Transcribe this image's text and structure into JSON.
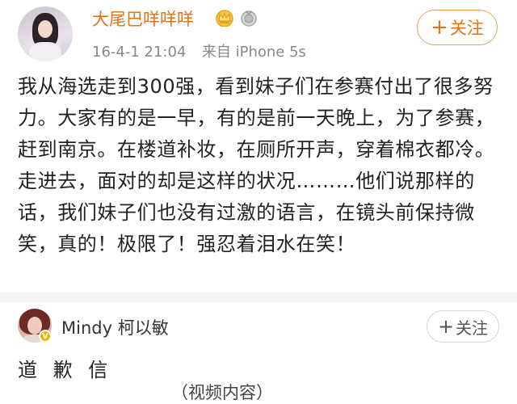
{
  "post": {
    "username": "大尾巴咩咩咩",
    "timestamp": "16-4-1 21:04",
    "source_prefix": "来自",
    "source": "iPhone 5s",
    "follow_label": "关注",
    "follow_plus": "+",
    "content": "我从海选走到300强，看到妹子们在参赛付出了很多努力。大家有的是一早，有的是前一天晚上，为了参赛，赶到南京。在楼道补妆，在厕所开声，穿着棉衣都冷。走进去，面对的却是这样的状况………他们说那样的话，我们妹子们也没有过激的语言，在镜头前保持微笑，真的！极限了！强忍着泪水在笑！",
    "badges": [
      "crown-badge-icon",
      "medal-badge-icon"
    ]
  },
  "post2": {
    "username": "Mindy 柯以敏",
    "follow_label": "关注",
    "follow_plus": "+",
    "title": "道 歉 信",
    "video_placeholder": "（视频内容）"
  },
  "colors": {
    "accent": "#e8720c",
    "meta": "#888888",
    "divider": "#f2f2f2"
  }
}
